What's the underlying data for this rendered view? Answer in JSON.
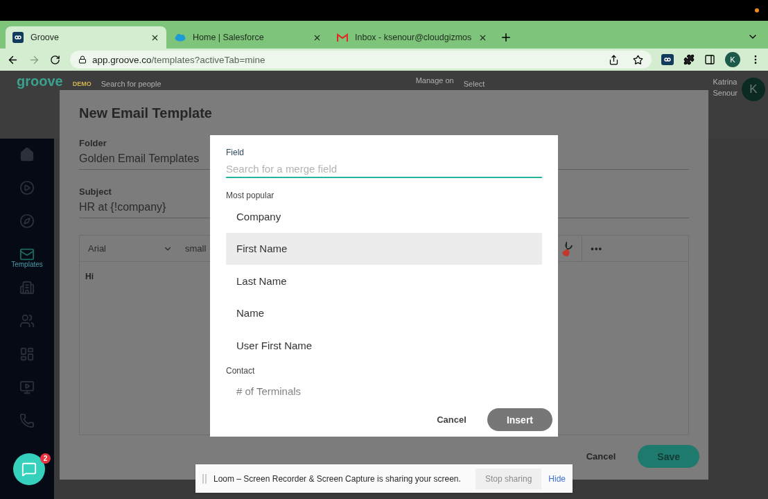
{
  "browser": {
    "tabs": [
      {
        "kind": "groove",
        "title": "Groove",
        "selected": true
      },
      {
        "kind": "salesforce",
        "title": "Home | Salesforce",
        "selected": false
      },
      {
        "kind": "gmail",
        "title": "Inbox - ksenour@cloudgizmos",
        "selected": false
      }
    ],
    "url_host": "app.groove.co",
    "url_path": "/templates?activeTab=mine",
    "profile": "K"
  },
  "app_header": {
    "logo": "groove",
    "badge": "DEMO",
    "search_placeholder": "Search for people",
    "manage_label": "Manage on",
    "select_placeholder": "Select",
    "user_first": "Katrina",
    "user_last": "Senour",
    "avatar": "K"
  },
  "sidebar": {
    "items": [
      {
        "kind": "home",
        "selected": false
      },
      {
        "kind": "play",
        "selected": false
      },
      {
        "kind": "compass",
        "selected": false
      },
      {
        "kind": "mail",
        "label": "Templates",
        "selected": true
      },
      {
        "kind": "building",
        "selected": false
      },
      {
        "kind": "people",
        "selected": false
      },
      {
        "kind": "dashboard",
        "selected": false
      },
      {
        "kind": "media",
        "selected": false
      },
      {
        "kind": "phone",
        "selected": false
      }
    ]
  },
  "template_modal": {
    "title": "New Email Template",
    "folder_label": "Folder",
    "folder_value": "Golden Email Templates",
    "subject_label": "Subject",
    "subject_value": "HR at {!company}",
    "editor": {
      "font": "Arial",
      "size": "small",
      "more": "•••",
      "body": "Hi"
    },
    "cancel": "Cancel",
    "save": "Save"
  },
  "merge_dialog": {
    "field_label": "Field",
    "placeholder": "Search for a merge field",
    "sections": [
      {
        "title": "Most popular",
        "items": [
          {
            "label": "Company",
            "highlighted": false
          },
          {
            "label": "First Name",
            "highlighted": true
          },
          {
            "label": "Last Name",
            "highlighted": false
          },
          {
            "label": "Name",
            "highlighted": false
          },
          {
            "label": "User First Name",
            "highlighted": false
          }
        ]
      },
      {
        "title": "Contact",
        "items": [
          {
            "label": "# of Terminals",
            "highlighted": false
          }
        ]
      }
    ],
    "cancel": "Cancel",
    "insert": "Insert"
  },
  "share_bar": {
    "message": "Loom – Screen Recorder & Screen Capture is sharing your screen.",
    "stop": "Stop sharing",
    "hide": "Hide"
  },
  "chat": {
    "badge": "2"
  }
}
